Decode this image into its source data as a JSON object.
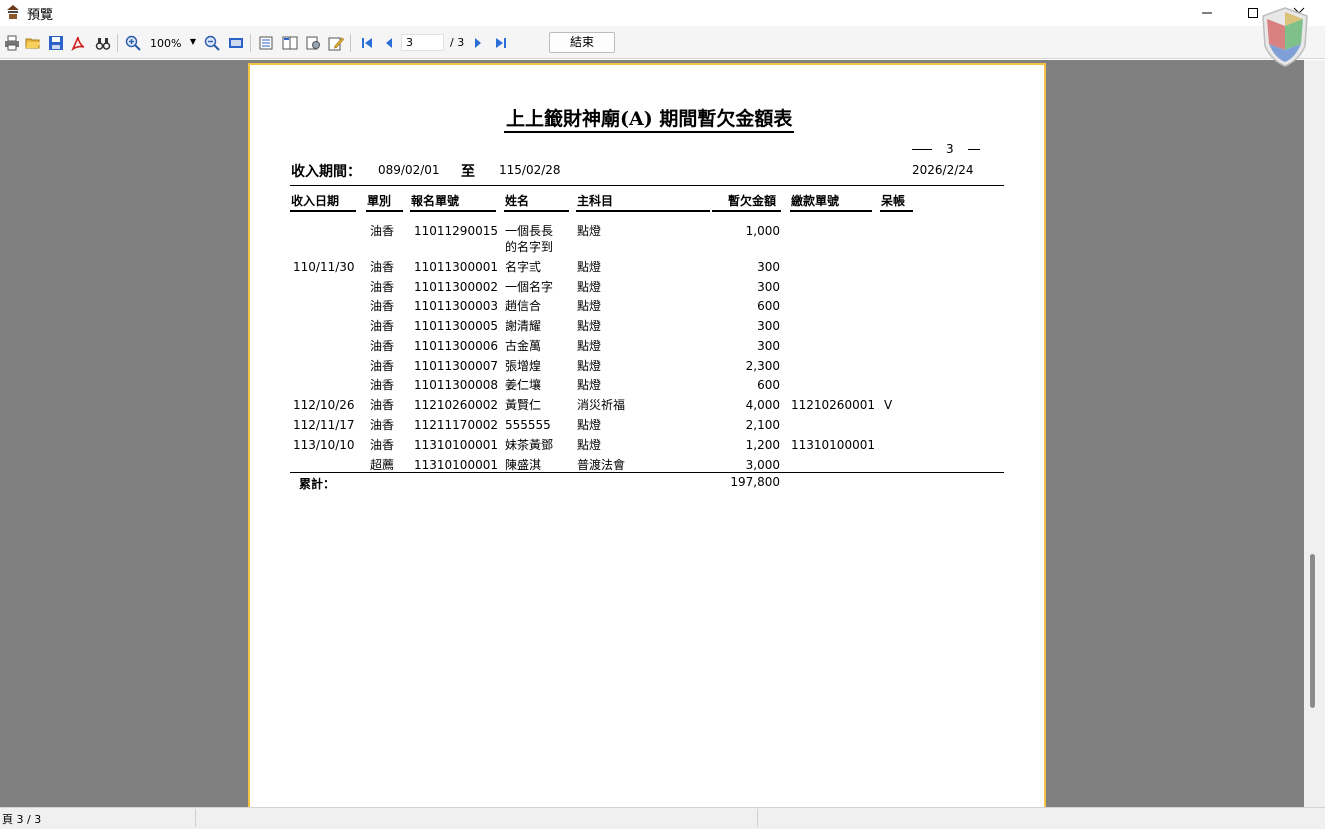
{
  "window": {
    "title": "預覽"
  },
  "toolbar": {
    "zoom": "100%",
    "current_page": "3",
    "page_total": "/ 3",
    "end_label": "結束"
  },
  "report": {
    "title": "上上籤財神廟(A) 期間暫欠金額表",
    "page_no": "3",
    "period_label": "收入期間：",
    "period_from": "089/02/01",
    "period_to_label": "至",
    "period_to": "115/02/28",
    "print_date": "2026/2/24",
    "columns": [
      "收入日期",
      "單別",
      "報名單號",
      "姓名",
      "主科目",
      "暫欠金額",
      "繳款單號",
      "呆帳"
    ],
    "rows": [
      {
        "date": "",
        "type": "油香",
        "no": "11011290015",
        "name": "一個長長",
        "name2": "的名字到",
        "subject": "點燈",
        "amount": "1,000",
        "pay_no": "",
        "bad": ""
      },
      {
        "date": "110/11/30",
        "type": "油香",
        "no": "11011300001",
        "name": "名字弎",
        "name2": "",
        "subject": "點燈",
        "amount": "300",
        "pay_no": "",
        "bad": ""
      },
      {
        "date": "",
        "type": "油香",
        "no": "11011300002",
        "name": "一個名字",
        "name2": "",
        "subject": "點燈",
        "amount": "300",
        "pay_no": "",
        "bad": ""
      },
      {
        "date": "",
        "type": "油香",
        "no": "11011300003",
        "name": "趙信合",
        "name2": "",
        "subject": "點燈",
        "amount": "600",
        "pay_no": "",
        "bad": ""
      },
      {
        "date": "",
        "type": "油香",
        "no": "11011300005",
        "name": "謝清耀",
        "name2": "",
        "subject": "點燈",
        "amount": "300",
        "pay_no": "",
        "bad": ""
      },
      {
        "date": "",
        "type": "油香",
        "no": "11011300006",
        "name": "古金萬",
        "name2": "",
        "subject": "點燈",
        "amount": "300",
        "pay_no": "",
        "bad": ""
      },
      {
        "date": "",
        "type": "油香",
        "no": "11011300007",
        "name": "張增煌",
        "name2": "",
        "subject": "點燈",
        "amount": "2,300",
        "pay_no": "",
        "bad": ""
      },
      {
        "date": "",
        "type": "油香",
        "no": "11011300008",
        "name": "姜仁壤",
        "name2": "",
        "subject": "點燈",
        "amount": "600",
        "pay_no": "",
        "bad": ""
      },
      {
        "date": "112/10/26",
        "type": "油香",
        "no": "11210260002",
        "name": "黃賢仁",
        "name2": "",
        "subject": "消災祈福",
        "amount": "4,000",
        "pay_no": "11210260001",
        "bad": "V"
      },
      {
        "date": "112/11/17",
        "type": "油香",
        "no": "11211170002",
        "name": "555555",
        "name2": "",
        "subject": "點燈",
        "amount": "2,100",
        "pay_no": "",
        "bad": ""
      },
      {
        "date": "113/10/10",
        "type": "油香",
        "no": "11310100001",
        "name": "妹茶黃鄧",
        "name2": "",
        "subject": "點燈",
        "amount": "1,200",
        "pay_no": "11310100001",
        "bad": ""
      },
      {
        "date": "",
        "type": "超薦",
        "no": "11310100001",
        "name": "陳盛淇",
        "name2": "",
        "subject": "普渡法會",
        "amount": "3,000",
        "pay_no": "",
        "bad": ""
      }
    ],
    "total_label": "累計：",
    "total_value": "197,800"
  },
  "status": {
    "text": "頁 3 / 3"
  },
  "colors": {
    "paper_border": "#f5c344",
    "viewport_bg": "#808080",
    "accent_blue": "#2a6fd6"
  }
}
